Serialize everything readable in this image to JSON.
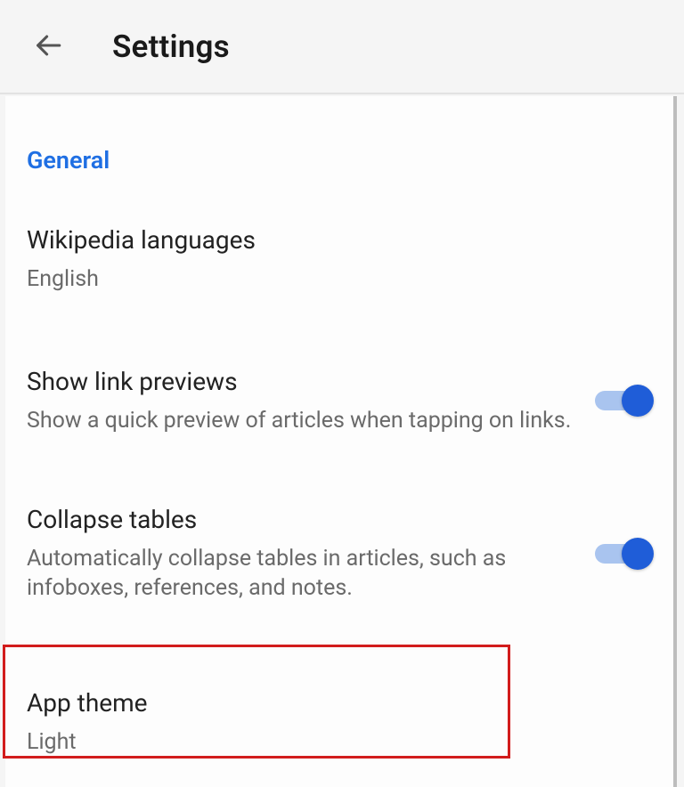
{
  "header": {
    "title": "Settings"
  },
  "section": {
    "label": "General"
  },
  "items": {
    "languages": {
      "title": "Wikipedia languages",
      "value": "English"
    },
    "link_previews": {
      "title": "Show link previews",
      "description": "Show a quick preview of articles when tapping on links.",
      "enabled": true
    },
    "collapse_tables": {
      "title": "Collapse tables",
      "description": "Automatically collapse tables in articles, such as infoboxes, references, and notes.",
      "enabled": true
    },
    "app_theme": {
      "title": "App theme",
      "value": "Light"
    }
  }
}
